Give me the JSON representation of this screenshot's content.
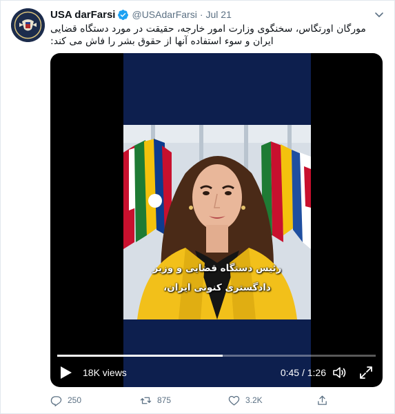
{
  "tweet": {
    "display_name": "USA darFarsi",
    "handle": "@USAdarFarsi",
    "separator": "·",
    "date": "Jul 21",
    "text": "مورگان اورتگاس، سخنگوی وزارت امور خارجه، حقیقت در مورد دستگاه قضایی ایران و سوء استفاده آنها از حقوق بشر را فاش می کند:"
  },
  "video": {
    "subtitle_line1": "رئیس دستگاه قضایی و وزیر",
    "subtitle_line2": "دادگستری کنونی ایران،",
    "views": "18K views",
    "time": "0:45 / 1:26",
    "progress": 0.52
  },
  "actions": {
    "reply_count": "250",
    "retweet_count": "875",
    "like_count": "3.2K"
  },
  "colors": {
    "accent": "#1da1f2",
    "muted": "#5b7083",
    "video_bg": "#0d1f4e"
  },
  "icons": [
    "more-icon",
    "verified-badge-icon",
    "play-icon",
    "volume-icon",
    "fullscreen-icon",
    "reply-icon",
    "retweet-icon",
    "like-icon",
    "share-icon"
  ]
}
